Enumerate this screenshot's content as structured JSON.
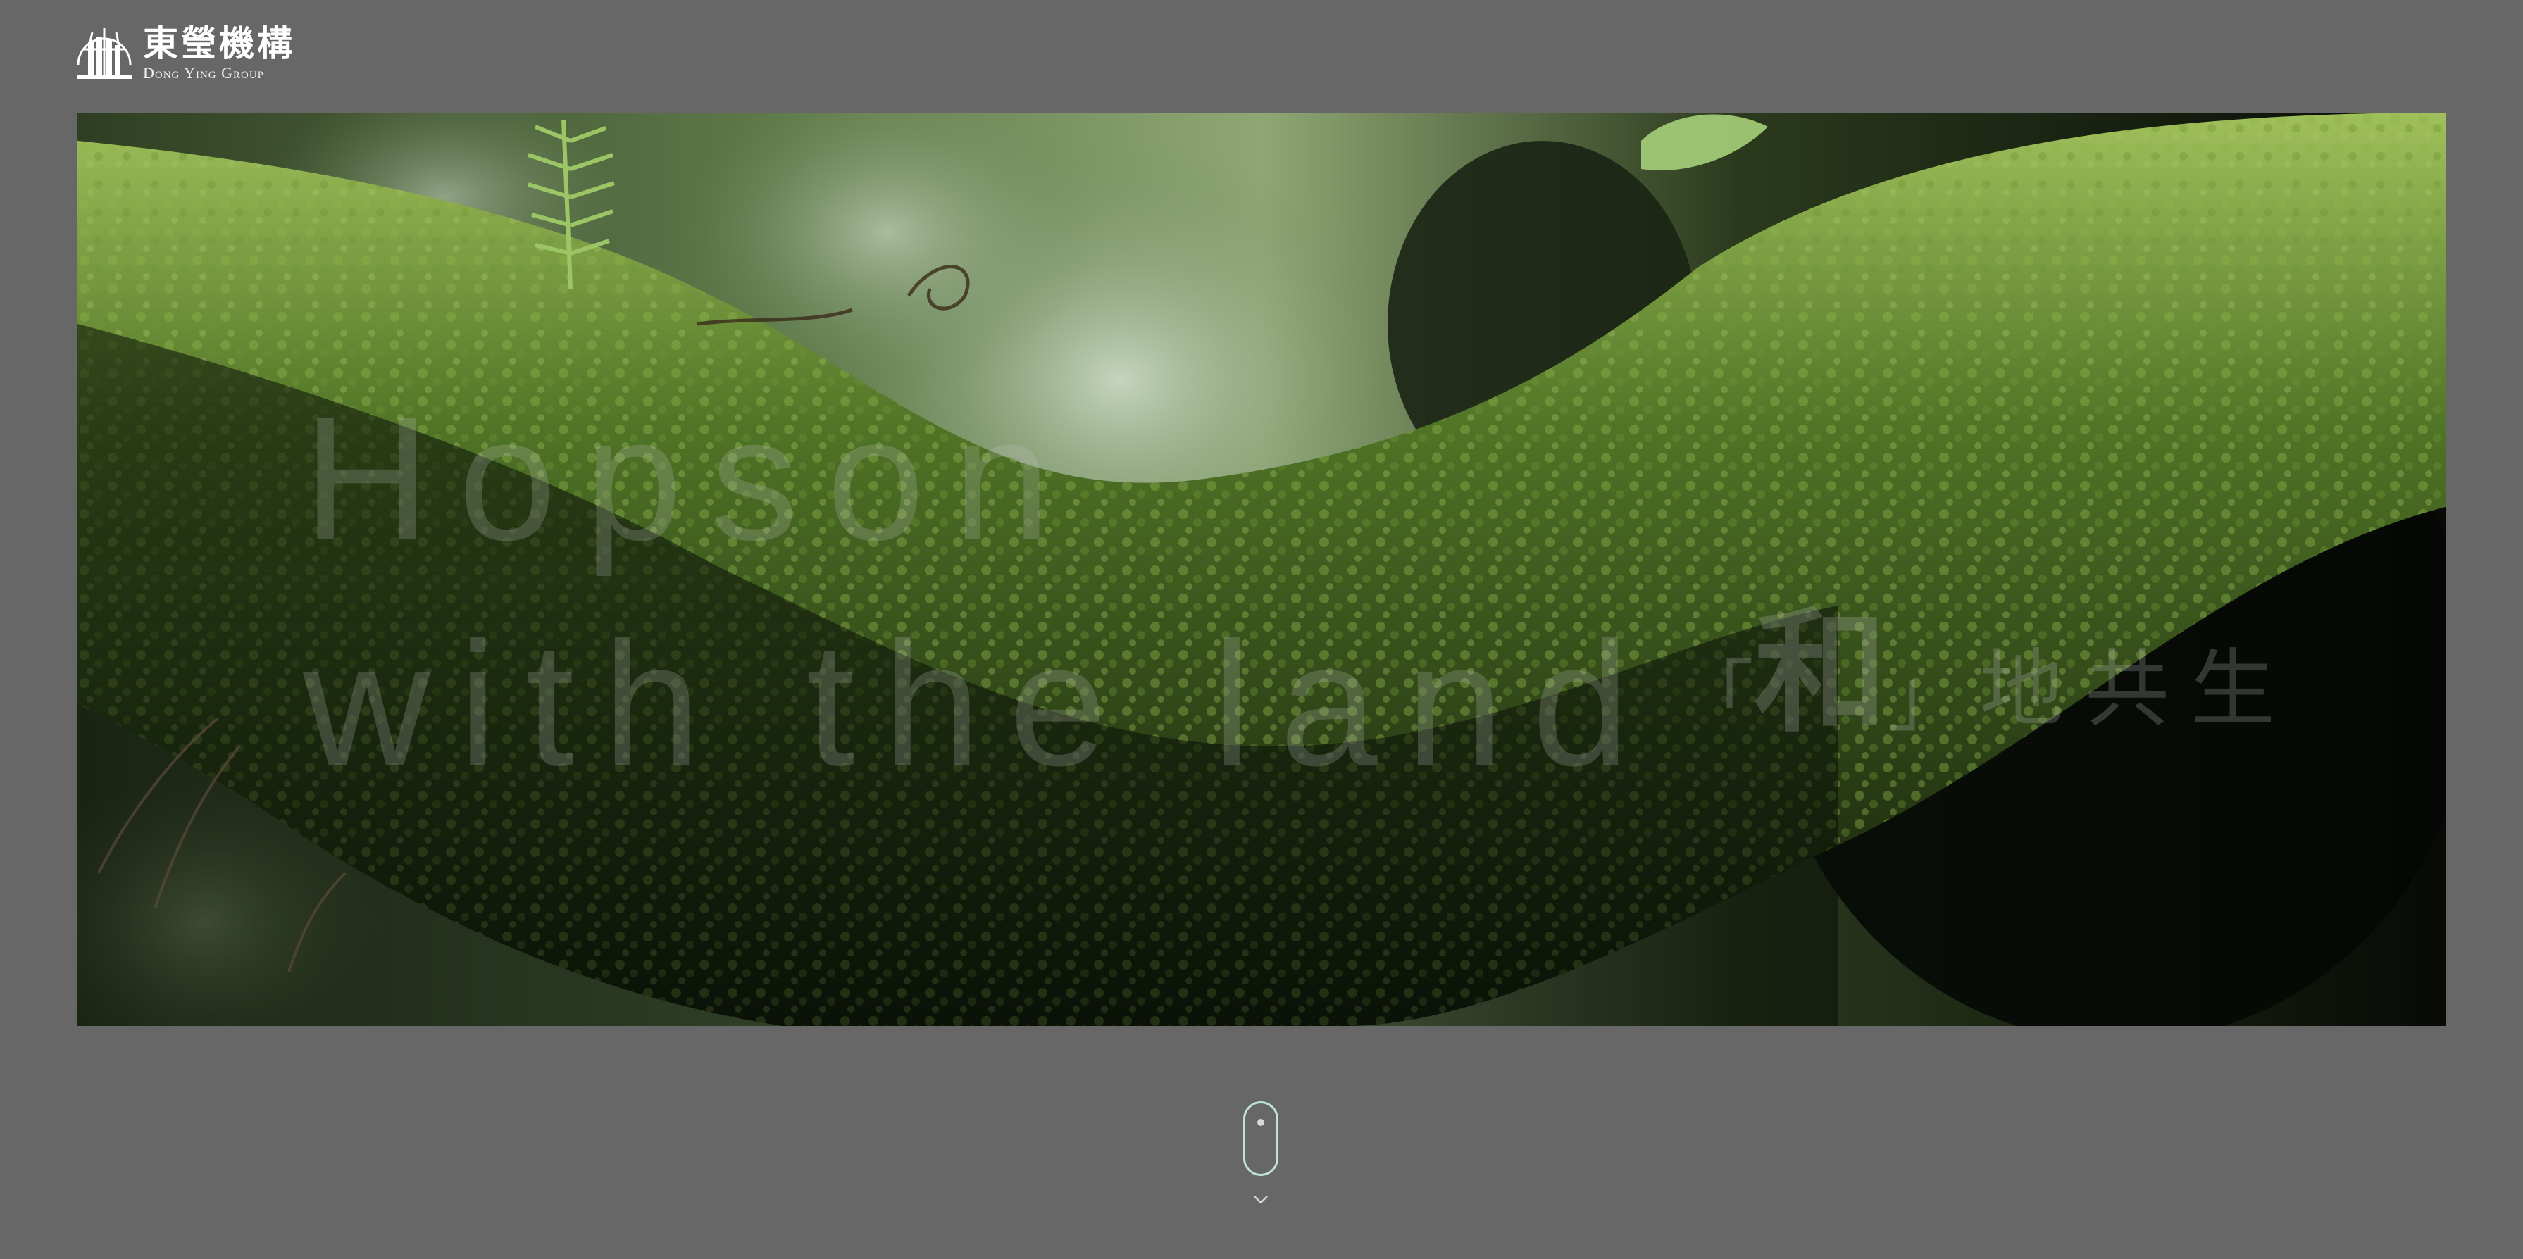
{
  "header": {
    "logo_cn": "東瑩機構",
    "logo_en": "Dong Ying Group"
  },
  "hero": {
    "title_line1": "Hopson",
    "title_line2": "with the land",
    "cn_bracket_open": "「",
    "cn_big": "和",
    "cn_bracket_close": "」",
    "cn_rest": "地共生"
  },
  "colors": {
    "background": "#676767",
    "scroll_indicator": "#bfe3d3"
  },
  "icons": {
    "logo": "globe-buildings-logo-icon",
    "scroll": "mouse-scroll-icon",
    "chevron": "chevron-down-icon"
  }
}
